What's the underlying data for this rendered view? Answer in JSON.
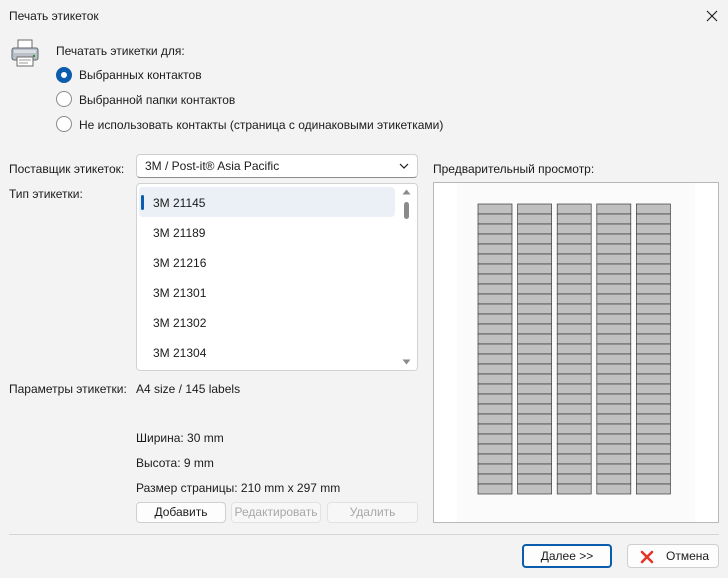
{
  "window": {
    "title": "Печать этикеток"
  },
  "print_for": {
    "label": "Печатать этикетки для:",
    "options": [
      {
        "label": "Выбранных контактов",
        "selected": true
      },
      {
        "label": "Выбранной папки контактов",
        "selected": false
      },
      {
        "label": "Не использовать контакты (страница с одинаковыми этикетками)",
        "selected": false
      }
    ]
  },
  "supplier": {
    "label": "Поставщик этикеток:",
    "value": "3M / Post-it®  Asia Pacific"
  },
  "label_type": {
    "label": "Тип этикетки:",
    "items": [
      "3M 21145",
      "3M 21189",
      "3M 21216",
      "3M 21301",
      "3M 21302",
      "3M 21304"
    ],
    "selected_index": 0
  },
  "params": {
    "label": "Параметры этикетки:",
    "summary": "A4 size / 145 labels",
    "width": "Ширина: 30 mm",
    "height": "Высота: 9 mm",
    "page_size": "Размер страницы: 210 mm x 297 mm"
  },
  "actions": {
    "add": "Добавить",
    "edit": "Редактировать",
    "delete": "Удалить"
  },
  "preview": {
    "label": "Предварительный просмотр:",
    "columns": 5,
    "rows": 29
  },
  "footer": {
    "next": "Далее >>",
    "cancel": "Отмена"
  },
  "colors": {
    "accent": "#0b5cad",
    "cancel_icon": "#e2362a",
    "label_fill": "#c0c0c0"
  },
  "icons": {
    "printer": "printer-icon",
    "close": "close-icon",
    "cancel": "x-mark-icon"
  }
}
